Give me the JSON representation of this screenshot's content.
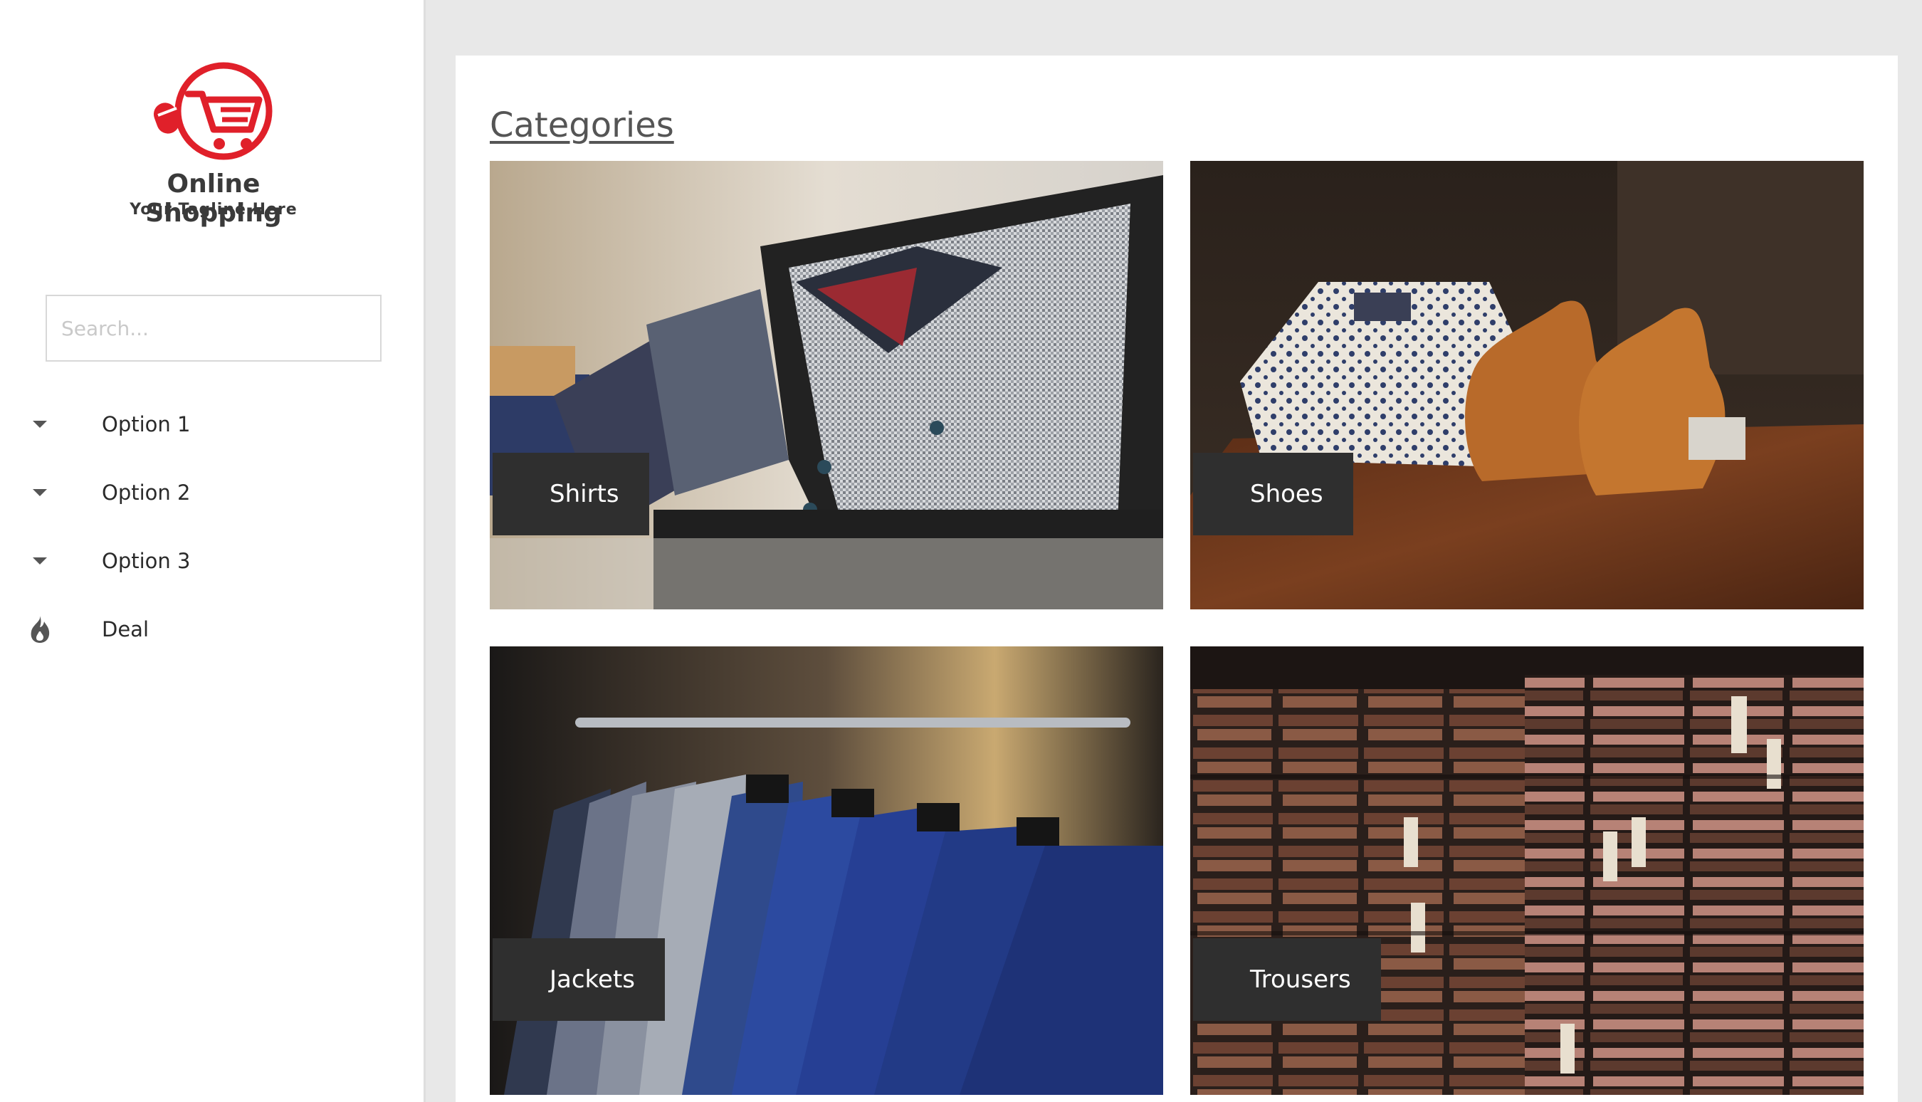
{
  "brand": {
    "name": "Online Shopping",
    "tagline": "Your Tagline Here",
    "accent_color": "#e0202a"
  },
  "search": {
    "placeholder": "Search..."
  },
  "menu": {
    "items": [
      {
        "label": "Option 1",
        "icon": "caret-down-icon"
      },
      {
        "label": "Option 2",
        "icon": "caret-down-icon"
      },
      {
        "label": "Option 3",
        "icon": "caret-down-icon"
      },
      {
        "label": "Deal",
        "icon": "flame-icon"
      }
    ]
  },
  "main": {
    "title": "Categories",
    "categories": [
      {
        "label": "Shirts",
        "image": "shirts-photo"
      },
      {
        "label": "Shoes",
        "image": "shoes-photo"
      },
      {
        "label": "Jackets",
        "image": "jackets-photo"
      },
      {
        "label": "Trousers",
        "image": "trousers-photo"
      }
    ]
  }
}
